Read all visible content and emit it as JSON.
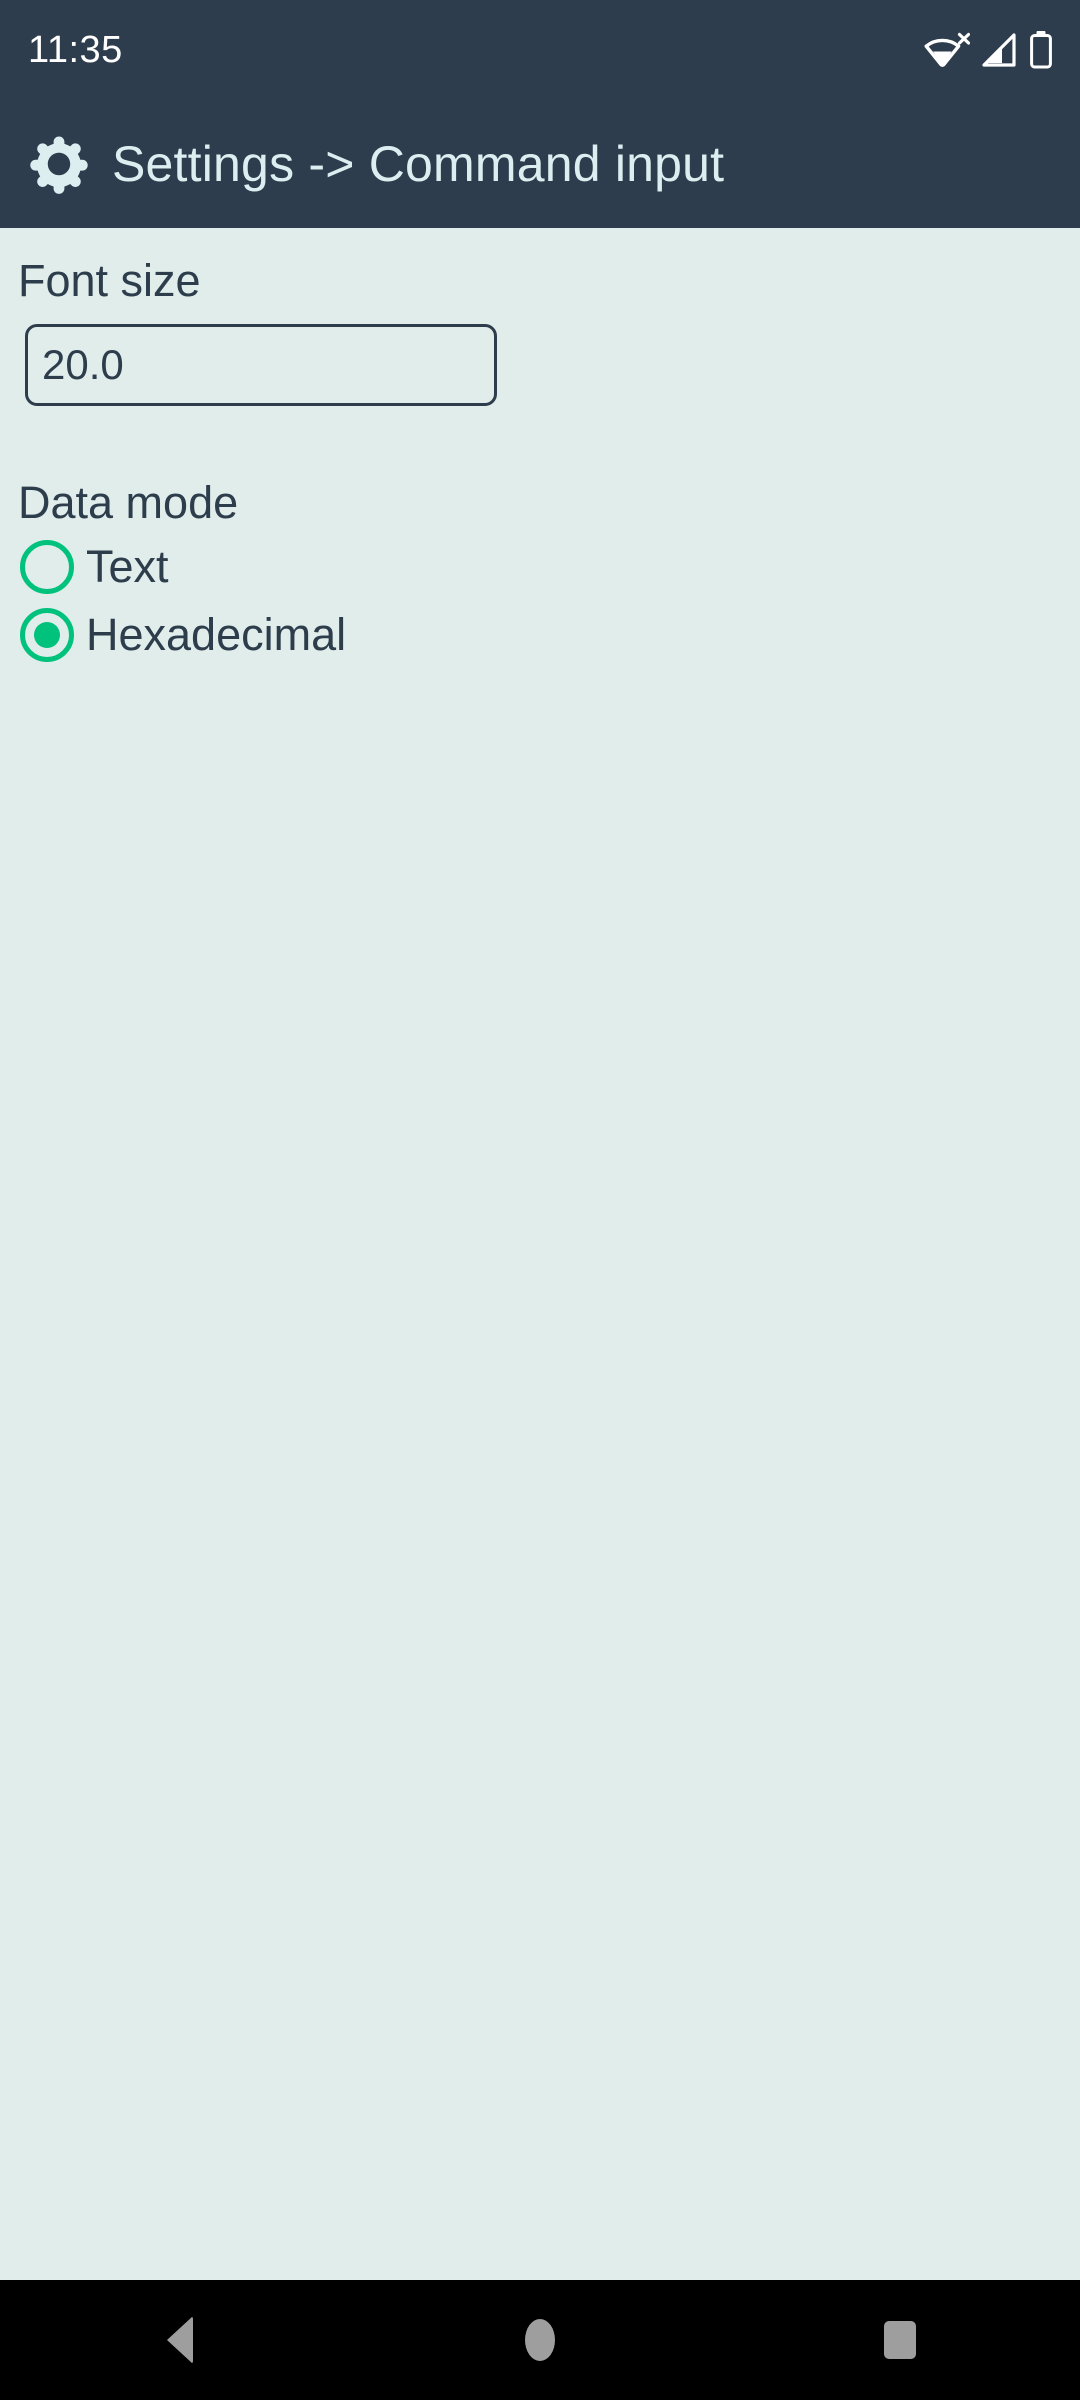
{
  "status_bar": {
    "time": "11:35",
    "icons": [
      {
        "name": "wifi-no-internet-icon",
        "label": "Wi-Fi disconnected"
      },
      {
        "name": "cellular-signal-icon",
        "label": "Mobile signal"
      },
      {
        "name": "battery-icon",
        "label": "Battery"
      }
    ],
    "background_color": "#2e3d4d",
    "text_color": "#ffffff"
  },
  "app_bar": {
    "icon": "gear-icon",
    "title": "Settings -> Command input",
    "background_color": "#2e3d4d",
    "title_color": "#dceef0"
  },
  "content": {
    "background_color": "#e0edeb",
    "text_color": "#2d3d4c",
    "font_size_field": {
      "label": "Font size",
      "value": "20.0",
      "placeholder": "20.0"
    },
    "data_mode": {
      "label": "Data mode",
      "accent_color": "#00c27c",
      "selected": "Hexadecimal",
      "options": [
        {
          "label": "Text",
          "checked": false
        },
        {
          "label": "Hexadecimal",
          "checked": true
        }
      ]
    }
  },
  "nav_bar": {
    "background_color": "#000000",
    "icon_color": "#9e9e9e",
    "buttons": [
      {
        "name": "nav-back-button",
        "label": "Back"
      },
      {
        "name": "nav-home-button",
        "label": "Home"
      },
      {
        "name": "nav-recents-button",
        "label": "Recents"
      }
    ]
  }
}
